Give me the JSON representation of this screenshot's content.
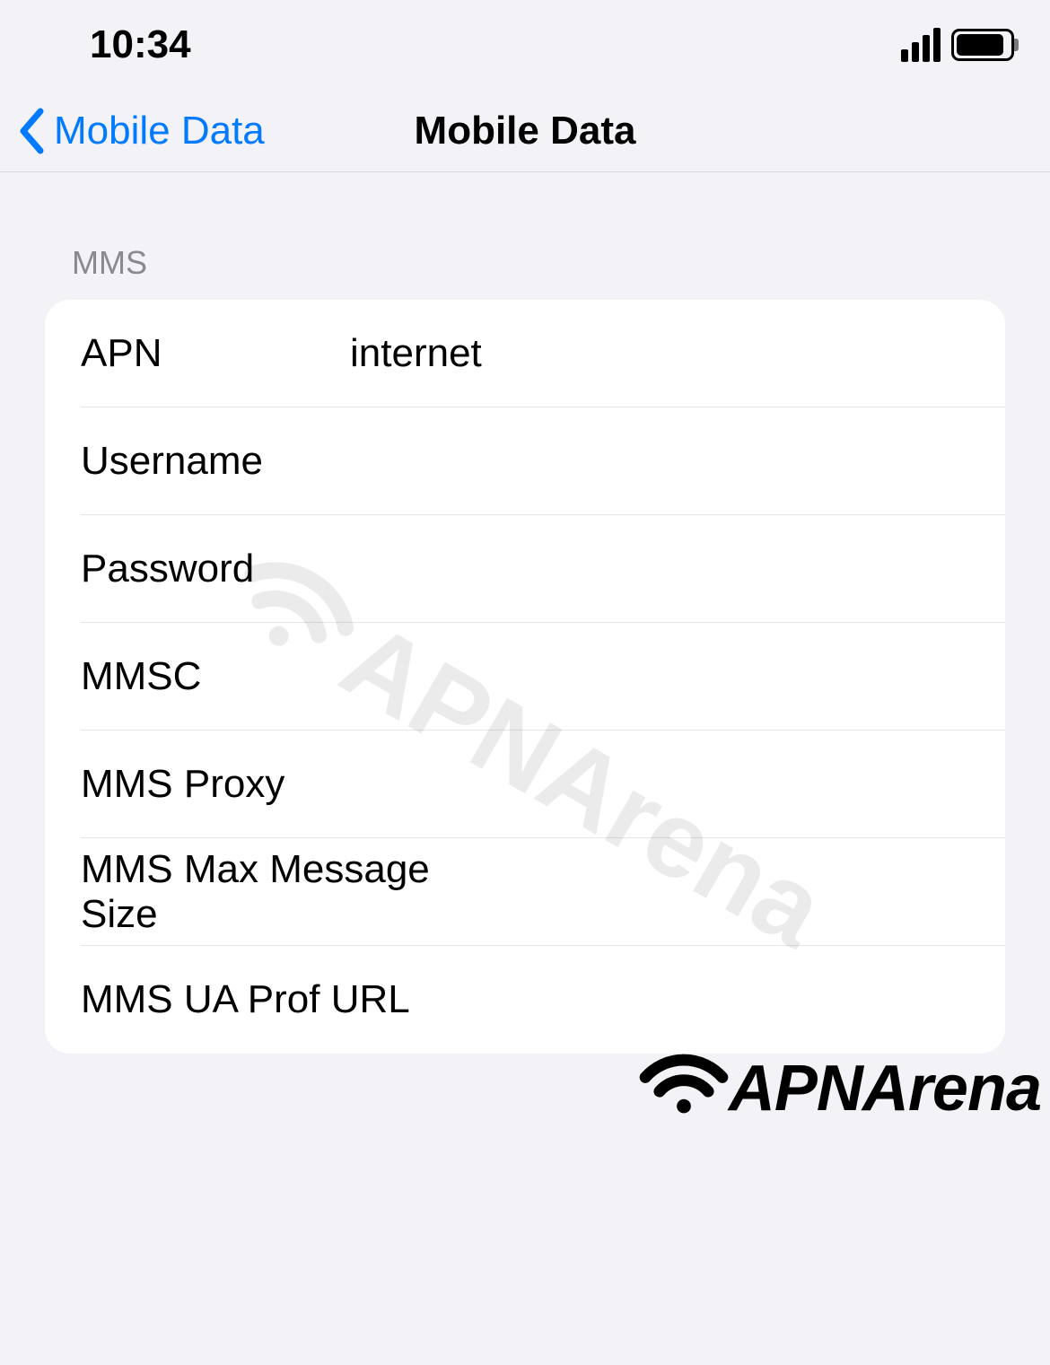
{
  "statusbar": {
    "time": "10:34"
  },
  "navbar": {
    "back_label": "Mobile Data",
    "title": "Mobile Data"
  },
  "section": {
    "header": "MMS",
    "rows": [
      {
        "label": "APN",
        "value": "internet"
      },
      {
        "label": "Username",
        "value": ""
      },
      {
        "label": "Password",
        "value": ""
      },
      {
        "label": "MMSC",
        "value": ""
      },
      {
        "label": "MMS Proxy",
        "value": ""
      },
      {
        "label": "MMS Max Message Size",
        "value": ""
      },
      {
        "label": "MMS UA Prof URL",
        "value": ""
      }
    ]
  },
  "watermark": {
    "text": "APNArena"
  },
  "branding": {
    "text": "APNArena"
  }
}
